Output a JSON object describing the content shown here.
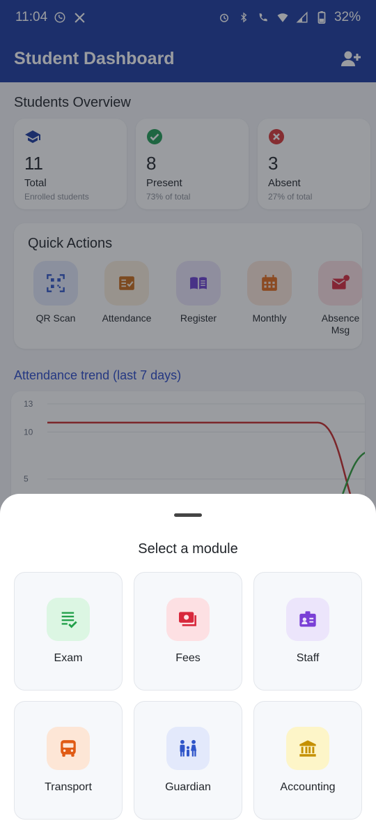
{
  "status_bar": {
    "time": "11:04",
    "battery": "32%"
  },
  "app_bar": {
    "title": "Student Dashboard"
  },
  "overview": {
    "title": "Students Overview",
    "cards": [
      {
        "value": "11",
        "label": "Total",
        "sub": "Enrolled students",
        "icon": "graduation-cap-icon",
        "color": "#1a3a9e"
      },
      {
        "value": "8",
        "label": "Present",
        "sub": "73% of total",
        "icon": "check-circle-icon",
        "color": "#1f9d55"
      },
      {
        "value": "3",
        "label": "Absent",
        "sub": "27% of total",
        "icon": "x-circle-icon",
        "color": "#d93636"
      }
    ]
  },
  "quick_actions": {
    "title": "Quick Actions",
    "items": [
      {
        "label": "QR Scan",
        "icon": "qr-scan-icon",
        "color": "#2f55c9",
        "bg": "#e3e9fb"
      },
      {
        "label": "Attendance",
        "icon": "attendance-icon",
        "color": "#c96a16",
        "bg": "#fbeedd"
      },
      {
        "label": "Register",
        "icon": "book-icon",
        "color": "#6a3fd1",
        "bg": "#ece5fb"
      },
      {
        "label": "Monthly",
        "icon": "calendar-icon",
        "color": "#e36b1a",
        "bg": "#fde8da"
      },
      {
        "label": "Absence\nMsg",
        "icon": "mail-alert-icon",
        "color": "#d8283c",
        "bg": "#fde0e3"
      }
    ]
  },
  "trend": {
    "title": "Attendance trend (last 7 days)"
  },
  "chart_data": {
    "type": "line",
    "yticks": [
      "13",
      "10",
      "5"
    ],
    "series": [
      {
        "color": "#c62828",
        "values": [
          11,
          11,
          11,
          11,
          11,
          11,
          0
        ]
      },
      {
        "color": "#2e9e3a",
        "values": [
          0,
          0,
          0,
          0,
          0,
          0,
          8
        ]
      }
    ]
  },
  "sheet": {
    "title": "Select a module",
    "modules": [
      {
        "label": "Exam",
        "icon": "exam-icon",
        "color": "#22a04a",
        "bg": "#dcf6e3"
      },
      {
        "label": "Fees",
        "icon": "money-icon",
        "color": "#d8283c",
        "bg": "#fde0e3"
      },
      {
        "label": "Staff",
        "icon": "id-badge-icon",
        "color": "#7a3fd6",
        "bg": "#ece5fb"
      },
      {
        "label": "Transport",
        "icon": "bus-icon",
        "color": "#e05a14",
        "bg": "#fde6d6"
      },
      {
        "label": "Guardian",
        "icon": "family-icon",
        "color": "#2f55c9",
        "bg": "#e3e9fb"
      },
      {
        "label": "Accounting",
        "icon": "bank-icon",
        "color": "#c59000",
        "bg": "#fdf5c8"
      }
    ]
  }
}
